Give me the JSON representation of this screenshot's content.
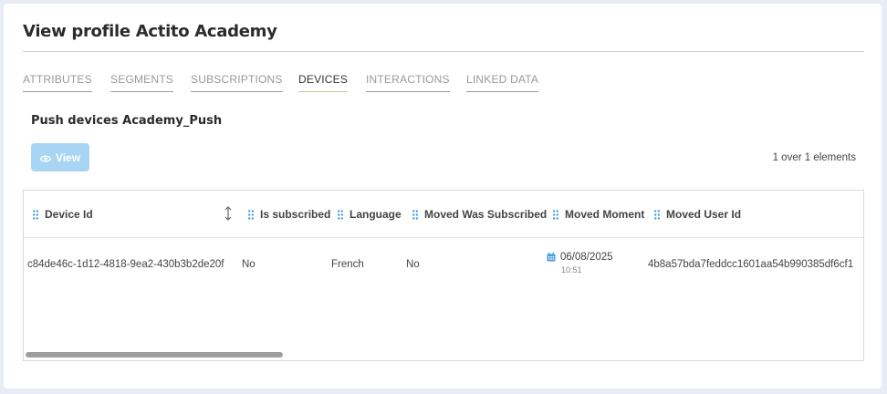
{
  "page": {
    "title": "View profile Actito Academy"
  },
  "tabs": [
    {
      "label": "ATTRIBUTES",
      "active": false
    },
    {
      "label": "SEGMENTS",
      "active": false
    },
    {
      "label": "SUBSCRIPTIONS",
      "active": false
    },
    {
      "label": "DEVICES",
      "active": true
    },
    {
      "label": "INTERACTIONS",
      "active": false
    },
    {
      "label": "LINKED DATA",
      "active": false
    }
  ],
  "section": {
    "title": "Push devices Academy_Push"
  },
  "toolbar": {
    "view_label": "View",
    "count_text": "1 over 1 elements"
  },
  "table": {
    "columns": [
      "Device Id",
      "Is subscribed",
      "Language",
      "Moved Was Subscribed",
      "Moved Moment",
      "Moved User Id"
    ],
    "rows": [
      {
        "device_id": "c84de46c-1d12-4818-9ea2-430b3b2de20f",
        "is_subscribed": "No",
        "language": "French",
        "moved_was_subscribed": "No",
        "moved_moment_date": "06/08/2025",
        "moved_moment_time": "10:51",
        "moved_user_id": "4b8a57bda7feddcc1601aa54b990385df6cf1"
      }
    ]
  },
  "colors": {
    "accent": "#a9d5f5",
    "icon_blue": "#4a9be0",
    "active_tab_underline": "#c7c79a"
  },
  "icons": {
    "view": "eye-icon",
    "column_handle": "grip-icon",
    "sort": "sort-icon",
    "date": "calendar-icon"
  }
}
